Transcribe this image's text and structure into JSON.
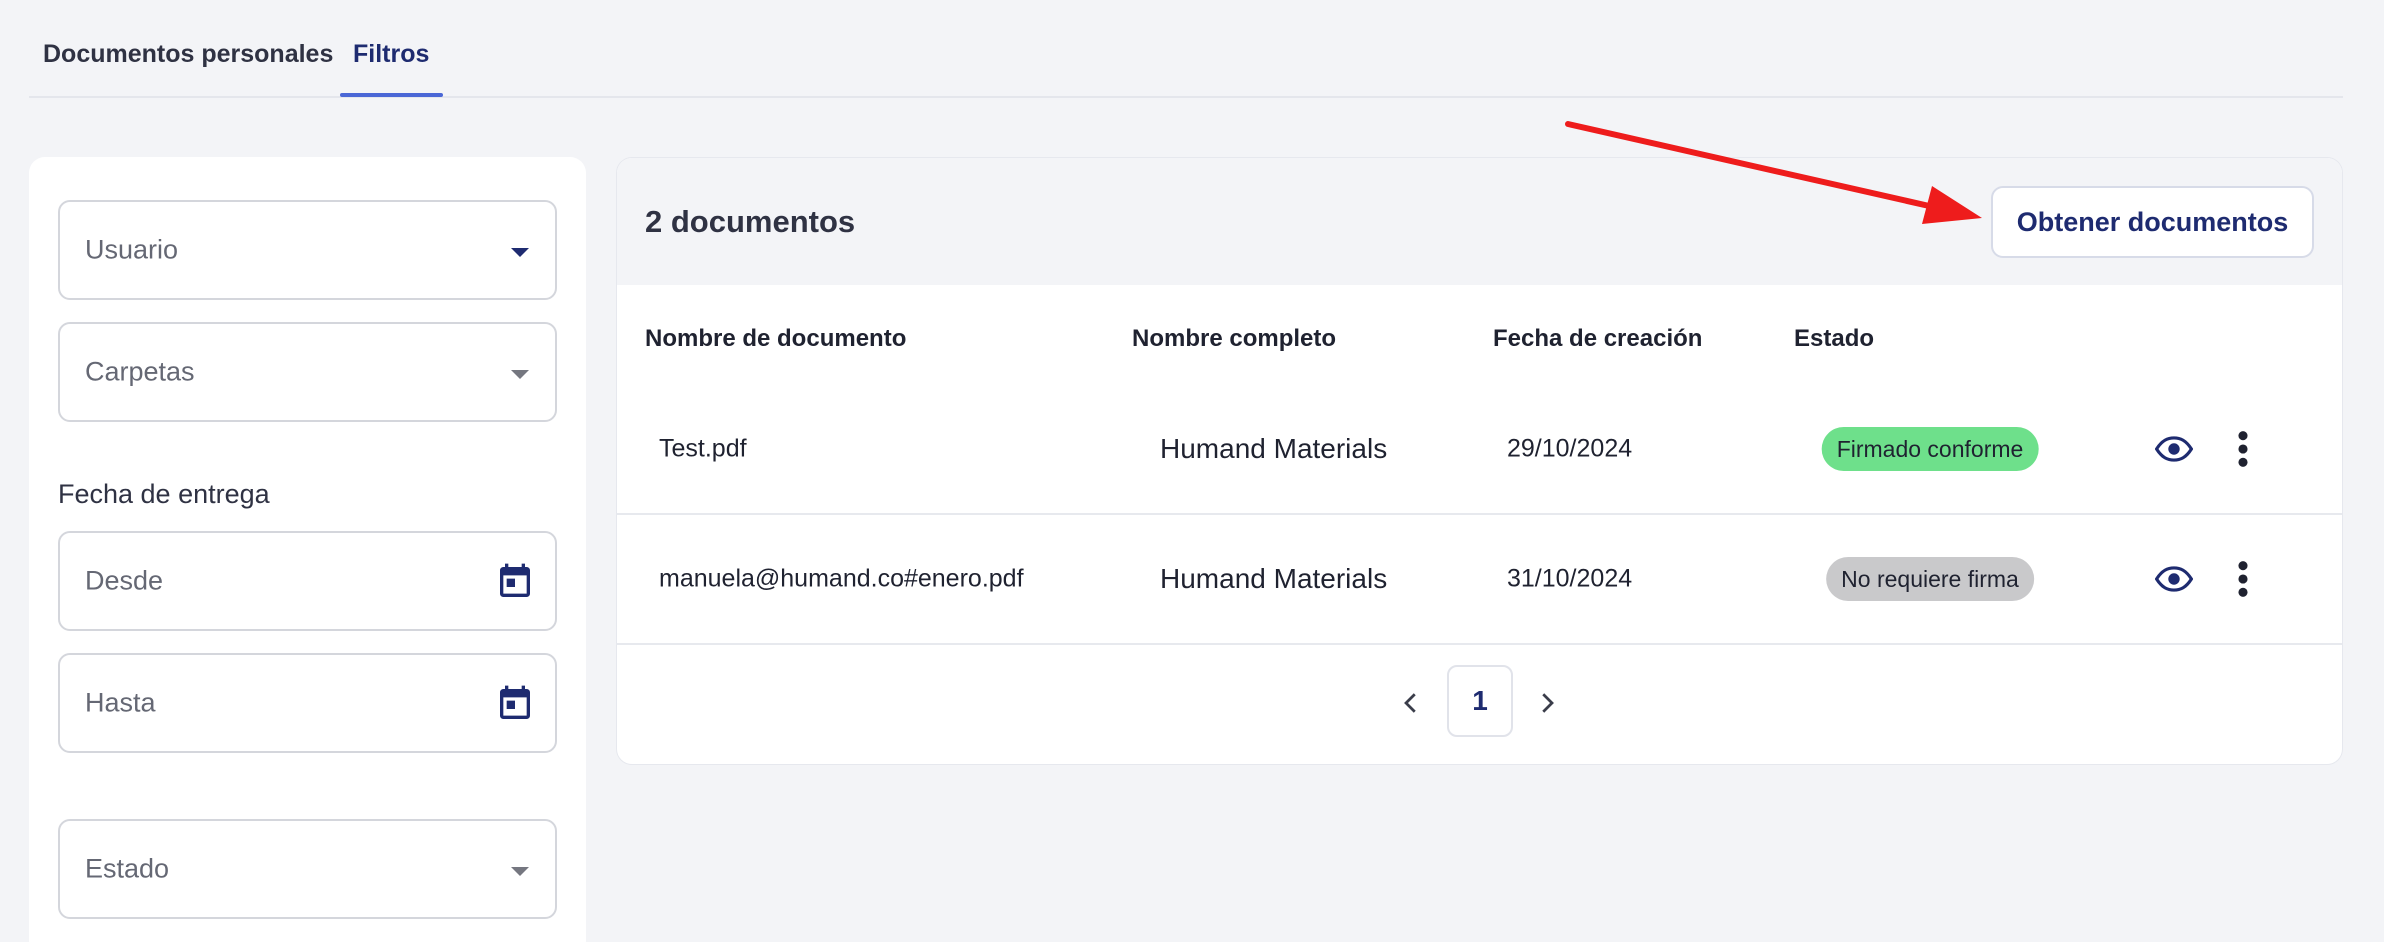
{
  "tabs": [
    {
      "label": "Documentos personales",
      "active": false
    },
    {
      "label": "Filtros",
      "active": true
    }
  ],
  "filters": {
    "usuario_placeholder": "Usuario",
    "carpetas_placeholder": "Carpetas",
    "fecha_entrega_label": "Fecha de entrega",
    "desde_placeholder": "Desde",
    "hasta_placeholder": "Hasta",
    "estado_placeholder": "Estado"
  },
  "main": {
    "count_label": "2 documentos",
    "get_documents_button": "Obtener documentos",
    "columns": [
      "Nombre de documento",
      "Nombre completo",
      "Fecha de creación",
      "Estado"
    ],
    "rows": [
      {
        "document": "Test.pdf",
        "full_name": "Humand Materials",
        "created": "29/10/2024",
        "status": "Firmado conforme",
        "status_color": "#6ee08b"
      },
      {
        "document": "manuela@humand.co#enero.pdf",
        "full_name": "Humand Materials",
        "created": "31/10/2024",
        "status": "No requiere firma",
        "status_color": "#c9c9cb"
      }
    ],
    "pagination": {
      "current_page": "1"
    }
  },
  "colors": {
    "accent": "#1e2b70",
    "tab_underline": "#4a67d6",
    "annotation_arrow": "#ee1c1c",
    "background": "#f3f4f7"
  },
  "icons": {
    "dropdown": "chevron-down-icon",
    "calendar": "calendar-icon",
    "view": "eye-icon",
    "more": "more-vertical-icon",
    "prev": "chevron-left-icon",
    "next": "chevron-right-icon"
  }
}
